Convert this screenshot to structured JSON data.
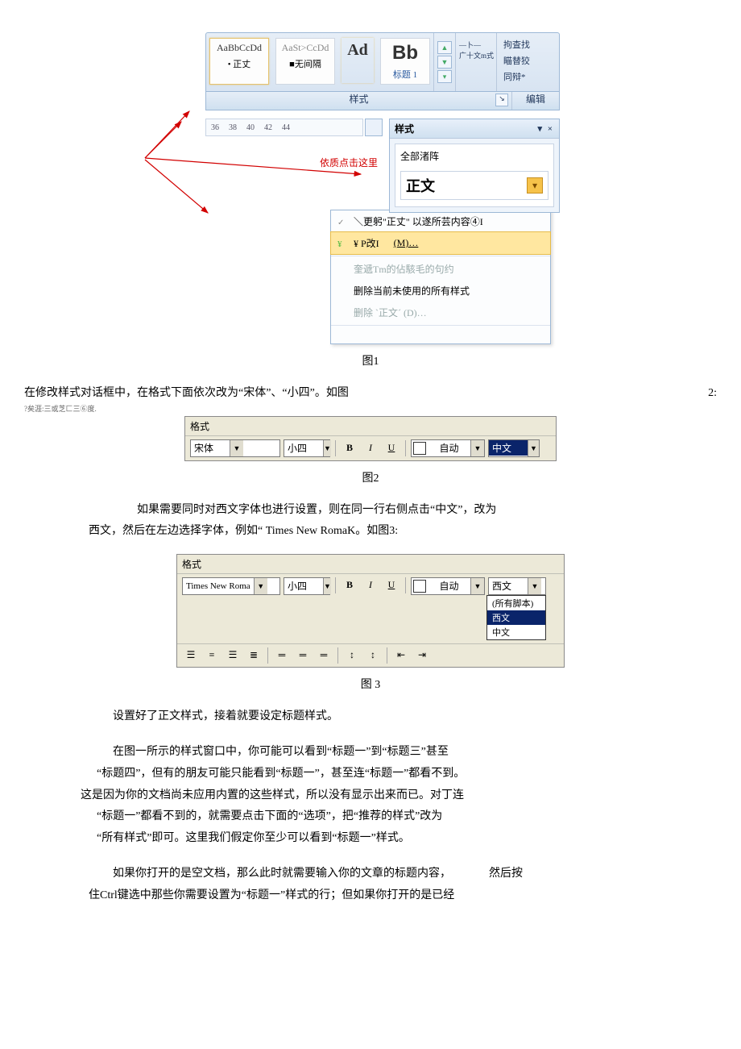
{
  "fig1": {
    "ribbon": {
      "tile1": {
        "sample": "AaBbCcDd",
        "label": "• 正丈"
      },
      "tile2": {
        "sample": "AaSt>CcDd",
        "label": "■无间隔"
      },
      "tile3": {
        "sample": "Ad",
        "label": ""
      },
      "tile4": {
        "sample": "Bb",
        "label": "标题 1"
      },
      "change_styles": "—卜—\n广十文m式",
      "find": "拘査找",
      "replace": "瞄替狡",
      "select": "同辩*"
    },
    "ribbon_labels": {
      "styles": "样式",
      "edit": "编辑"
    },
    "ruler_marks": [
      "36",
      "38",
      "40",
      "42",
      "44"
    ],
    "styles_pane": {
      "title": "样式",
      "close": "▾ ×",
      "clear_all": "全部渚阵",
      "normal": "正文"
    },
    "red_note": "依质点击这里",
    "context_menu": {
      "update": "＼更躬\"正丈\" 以遂所芸内容④I",
      "modify": "¥ P改I",
      "modify_key": "(M)…",
      "select_all": "奎遞Tm的佔駭毛的句约",
      "del_unused": "删除当前未使用的所有样式",
      "del_normal": "删除 ˋ正文ˊ (D)…"
    },
    "caption": "图1"
  },
  "footnote": "?矣涯:三或芝匚三⑥度.",
  "para1": {
    "text": "在修改样式对话框中，在格式下面依次改为“宋体”、“小四”。如图",
    "num": "2:"
  },
  "fig2": {
    "header": "格式",
    "font": "宋体",
    "size": "小四",
    "bold": "B",
    "italic": "I",
    "underline": "U",
    "color_label": "自动",
    "lang": "中文",
    "caption": "图2"
  },
  "para2": "如果需要同时对西文字体也进行设置，则在同一行右侧点击“中文”，改为",
  "para2b": "西文，然后在左边选择字体，例如“ Times New RomaK。如图3:",
  "fig3": {
    "header": "格式",
    "font": "Times New Roma",
    "size": "小四",
    "bold": "B",
    "italic": "I",
    "underline": "U",
    "color_label": "自动",
    "lang": "西文",
    "opts": {
      "all": "(所有脚本)",
      "xi": "西文",
      "zh": "中文"
    },
    "caption": "图 3"
  },
  "para3": "设置好了正文样式，接着就要设定标题样式。",
  "para4a": "在图一所示的样式窗口中，你可能可以看到“标题一”到“标题三”甚至",
  "para4b": "“标题四”，但有的朋友可能只能看到“标题一”，甚至连“标题一”都看不到。",
  "para4c": "这是因为你的文档尚未应用内置的这些样式，所以没有显示出来而已。对丁连",
  "para4d": "“标题一”都看不到的，就需要点击下面的“选项”，把“推荐的样式”改为",
  "para4e": "“所有样式”即可。这里我们假定你至少可以看到“标题一”样式。",
  "para5a": "如果你打开的是空文档，那么此时就需要输入你的文章的标题内容，",
  "para5a_right": "然后按",
  "para5b": "住Ctrl键选中那些你需要设置为“标题一”样式的行；但如果你打开的是已经"
}
